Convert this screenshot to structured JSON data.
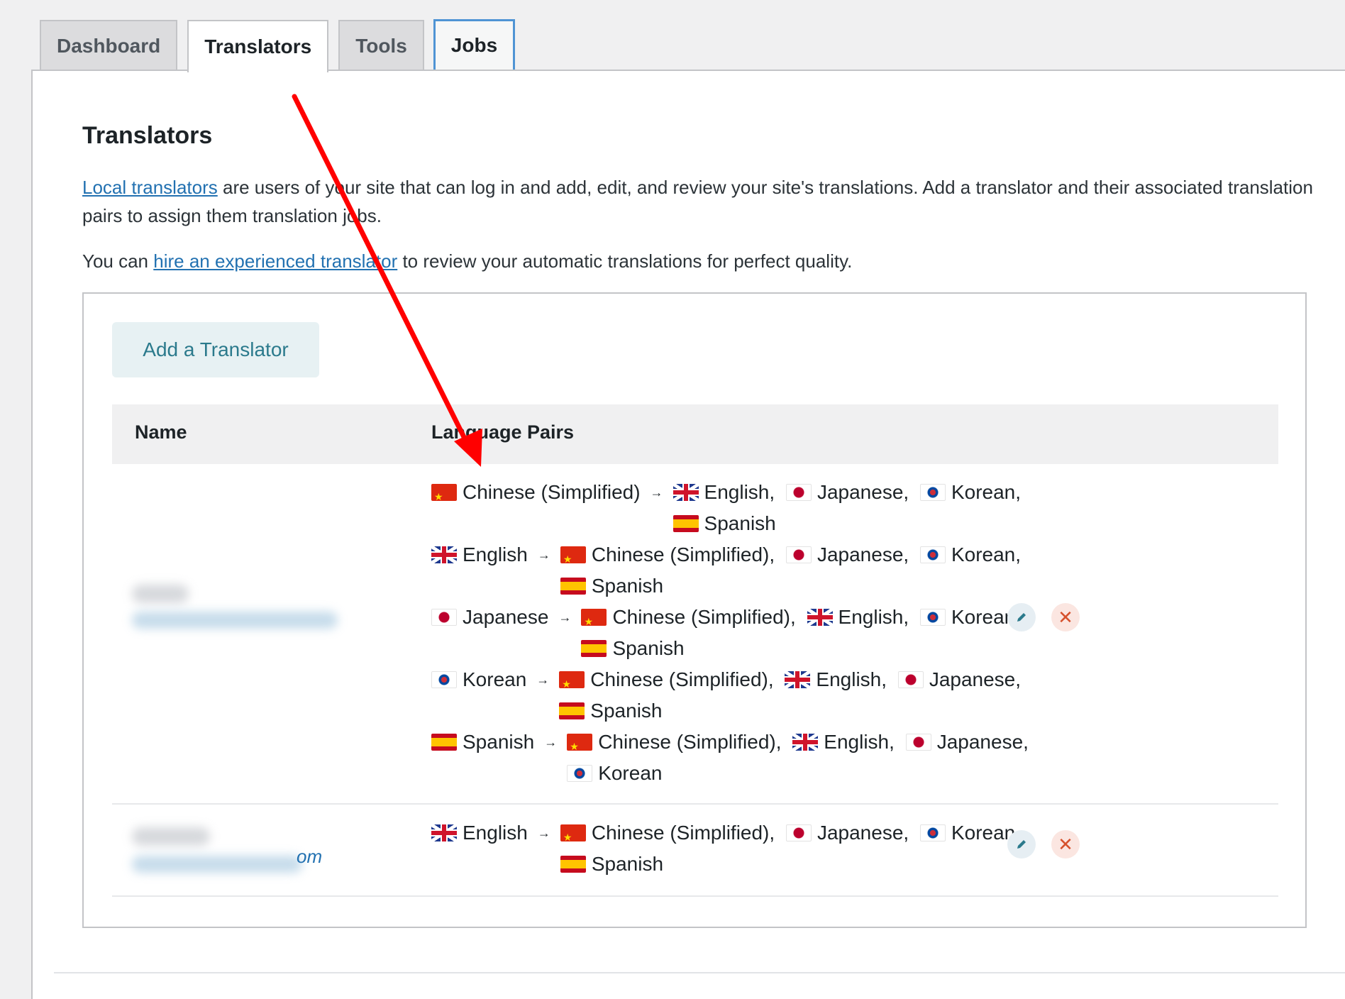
{
  "tabs": [
    {
      "label": "Dashboard"
    },
    {
      "label": "Translators"
    },
    {
      "label": "Tools"
    },
    {
      "label": "Jobs"
    }
  ],
  "page": {
    "title": "Translators",
    "desc_link": "Local translators",
    "desc_text": " are users of your site that can log in and add, edit, and review your site's translations. Add a translator and their associated translation pairs to assign them translation jobs.",
    "hire_prefix": "You can ",
    "hire_link": "hire an experienced translator",
    "hire_suffix": " to review your automatic translations for perfect quality."
  },
  "add_button": "Add a Translator",
  "table": {
    "headers": {
      "name": "Name",
      "pairs": "Language Pairs"
    },
    "rows": [
      {
        "pairs": [
          {
            "source": "Chinese (Simplified)",
            "source_flag": "cn",
            "targets": [
              {
                "name": "English,",
                "flag": "gb"
              },
              {
                "name": "Japanese,",
                "flag": "jp"
              },
              {
                "name": "Korean,",
                "flag": "kr"
              },
              {
                "name": "Spanish",
                "flag": "es"
              }
            ]
          },
          {
            "source": "English",
            "source_flag": "gb",
            "targets": [
              {
                "name": "Chinese (Simplified),",
                "flag": "cn"
              },
              {
                "name": "Japanese,",
                "flag": "jp"
              },
              {
                "name": "Korean,",
                "flag": "kr"
              },
              {
                "name": "Spanish",
                "flag": "es"
              }
            ]
          },
          {
            "source": "Japanese",
            "source_flag": "jp",
            "targets": [
              {
                "name": "Chinese (Simplified),",
                "flag": "cn"
              },
              {
                "name": "English,",
                "flag": "gb"
              },
              {
                "name": "Korean,",
                "flag": "kr"
              },
              {
                "name": "Spanish",
                "flag": "es"
              }
            ]
          },
          {
            "source": "Korean",
            "source_flag": "kr",
            "targets": [
              {
                "name": "Chinese (Simplified),",
                "flag": "cn"
              },
              {
                "name": "English,",
                "flag": "gb"
              },
              {
                "name": "Japanese,",
                "flag": "jp"
              },
              {
                "name": "Spanish",
                "flag": "es"
              }
            ]
          },
          {
            "source": "Spanish",
            "source_flag": "es",
            "targets": [
              {
                "name": "Chinese (Simplified),",
                "flag": "cn"
              },
              {
                "name": "English,",
                "flag": "gb"
              },
              {
                "name": "Japanese,",
                "flag": "jp"
              },
              {
                "name": "Korean",
                "flag": "kr"
              }
            ]
          }
        ]
      },
      {
        "email_tail": "om",
        "pairs": [
          {
            "source": "English",
            "source_flag": "gb",
            "targets": [
              {
                "name": "Chinese (Simplified),",
                "flag": "cn"
              },
              {
                "name": "Japanese,",
                "flag": "jp"
              },
              {
                "name": "Korean,",
                "flag": "kr"
              },
              {
                "name": "Spanish",
                "flag": "es"
              }
            ]
          }
        ]
      }
    ]
  },
  "arrow_symbol": "→",
  "delete_symbol": "✕",
  "colors": {
    "accent": "#2271b1",
    "annotation_arrow": "#ff0000",
    "delete": "#d6512c",
    "button_text": "#2b7a8c"
  }
}
